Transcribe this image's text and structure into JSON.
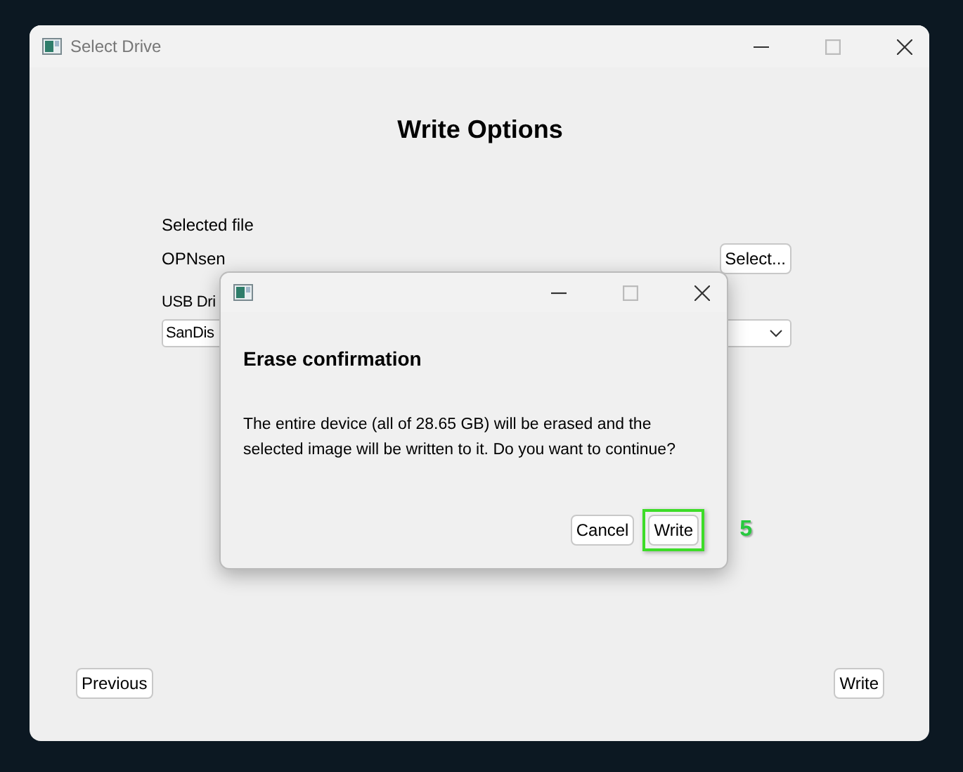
{
  "window": {
    "title": "Select Drive"
  },
  "page": {
    "heading": "Write Options",
    "file_label": "Selected file",
    "file_name": "OPNsen",
    "select_button": "Select...",
    "drive_label": "USB Dri",
    "drive_value": "SanDis"
  },
  "footer": {
    "previous_button": "Previous",
    "write_button": "Write"
  },
  "dialog": {
    "heading": "Erase confirmation",
    "message": "The entire device (all of 28.65 GB) will be erased and the selected image will be written to it. Do you want to continue?",
    "buttons": [
      {
        "label": "Cancel",
        "highlighted": false
      },
      {
        "label": "Write",
        "highlighted": true
      }
    ]
  },
  "annotation": {
    "label": "5"
  }
}
